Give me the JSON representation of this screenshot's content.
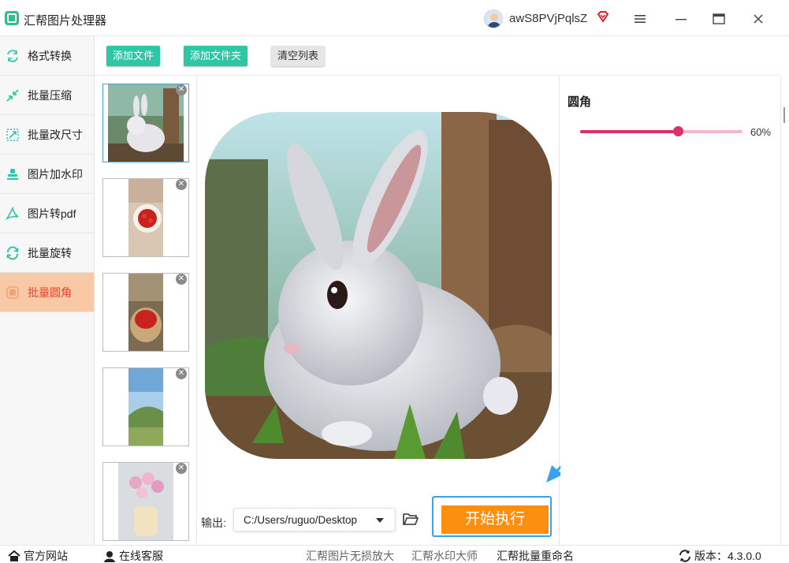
{
  "app": {
    "title": "汇帮图片处理器",
    "username": "awS8PVjPqlsZ"
  },
  "window": {
    "menu_icon": "hamburger-icon",
    "minimize_icon": "minimize-icon",
    "maximize_icon": "maximize-icon",
    "close_icon": "close-icon"
  },
  "sidebar": {
    "items": [
      {
        "label": "格式转换",
        "icon": "convert-icon"
      },
      {
        "label": "批量压缩",
        "icon": "compress-icon"
      },
      {
        "label": "批量改尺寸",
        "icon": "resize-icon"
      },
      {
        "label": "图片加水印",
        "icon": "stamp-icon"
      },
      {
        "label": "图片转pdf",
        "icon": "pdf-icon"
      },
      {
        "label": "批量旋转",
        "icon": "rotate-icon"
      },
      {
        "label": "批量圆角",
        "icon": "rounded-corner-icon",
        "active": true
      }
    ]
  },
  "toolbar": {
    "add_file": "添加文件",
    "add_folder": "添加文件夹",
    "clear_list": "清空列表"
  },
  "thumbnails": [
    {
      "subject": "rabbit",
      "selected": true
    },
    {
      "subject": "strawberries-plate"
    },
    {
      "subject": "strawberries-basket"
    },
    {
      "subject": "hillside-landscape"
    },
    {
      "subject": "tulips-vase"
    }
  ],
  "preview": {
    "corner_radius_percent": 60
  },
  "output": {
    "label": "输出:",
    "path": "C:/Users/ruguo/Desktop"
  },
  "run_button": "开始执行",
  "settings": {
    "title": "圆角",
    "slider_value": 60,
    "slider_text": "60%"
  },
  "statusbar": {
    "website": "官方网站",
    "support": "在线客服",
    "link1": "汇帮图片无损放大",
    "link2": "汇帮水印大师",
    "link3": "汇帮批量重命名",
    "version": "版本：4.3.0.0"
  },
  "colors": {
    "accent_green": "#2ec7a5",
    "active_orange": "#f9c9a6",
    "slider_pink": "#de2f6a",
    "run_orange": "#fd8f10",
    "highlight_blue": "#3aa2ea"
  }
}
